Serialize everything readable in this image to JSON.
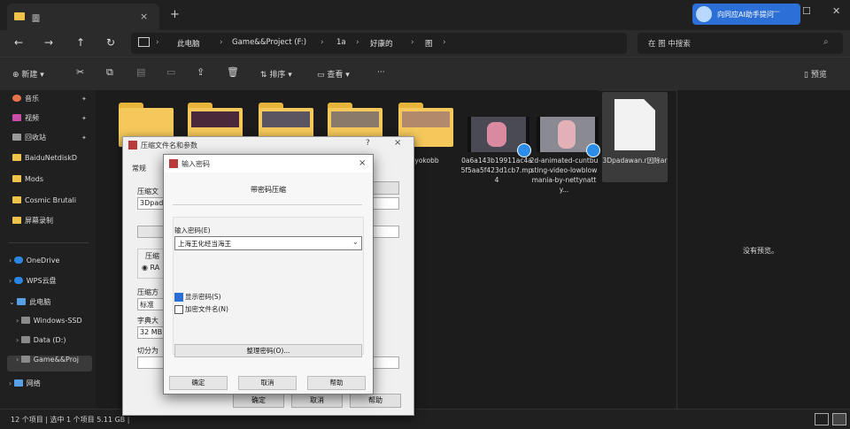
{
  "window": {
    "tab_title": "圖",
    "tab_close": "×",
    "new_tab": "+",
    "badge": "向同应AI助手提问",
    "min": "—",
    "max": "☐",
    "close": "✕"
  },
  "nav": {
    "back": "←",
    "forward": "→",
    "up": "↑",
    "refresh": "↻",
    "breadcrumbs": [
      "此电脑",
      "Game&&Project (F:)",
      "1a",
      "好康的",
      "图"
    ],
    "search_placeholder": "在 图 中搜索"
  },
  "toolbar": {
    "new_label": "新建",
    "sort_label": "排序",
    "view_label": "查看",
    "more_label": "···",
    "details_label": "预览",
    "icons": [
      "cut-icon",
      "copy-icon",
      "paste-icon",
      "rename-icon",
      "share-icon",
      "delete-icon"
    ]
  },
  "sidebar": {
    "pinned": [
      {
        "label": "音乐",
        "color": "#e8734a"
      },
      {
        "label": "视频",
        "color": "#c74fa8"
      },
      {
        "label": "回收站",
        "color": "#9a9a9a"
      }
    ],
    "folders": [
      {
        "label": "BaiduNetdiskD"
      },
      {
        "label": "Mods"
      },
      {
        "label": "Cosmic Brutali"
      },
      {
        "label": "屏幕录制"
      }
    ],
    "drives": [
      {
        "label": "OneDrive",
        "color": "#2a86e0"
      },
      {
        "label": "WPS云盘",
        "color": "#2a86e0"
      },
      {
        "label": "此电脑",
        "color": "#5aa0e8"
      },
      {
        "label": "Windows-SSD",
        "color": "#8a8a8a"
      },
      {
        "label": "Data (D:)",
        "color": "#8a8a8a"
      },
      {
        "label": "Game&&Proj",
        "color": "#8a8a8a"
      },
      {
        "label": "网络",
        "color": "#5aa0e8"
      }
    ]
  },
  "files": [
    {
      "name": "yokobb",
      "type": "folder"
    },
    {
      "name": "0a6a143b19911ac4a5f5aa5f423d1cb7.mp4",
      "type": "video"
    },
    {
      "name": "2d-animated-cuntbusting-video-lowblowmania-by-nettynatty...",
      "type": "video"
    },
    {
      "name": "3Dpadawan.r因除ar",
      "type": "archive"
    }
  ],
  "preview": {
    "empty_text": "没有预览。"
  },
  "status": {
    "text": "12 个项目  |  选中 1 个项目  5.11 GB  |"
  },
  "archive_dialog": {
    "title": "压缩文件名和参数",
    "help": "?",
    "close": "×",
    "tab_general": "常规",
    "filename_label": "压缩文",
    "filename_value": "3Dpad",
    "format_label": "压缩",
    "format_option": "RA",
    "method_label": "压缩方",
    "method_value": "标准",
    "dict_label": "字典大",
    "dict_value": "32 MB",
    "split_label": "切分为",
    "btn_ok": "确定",
    "btn_cancel": "取消",
    "btn_help": "帮助"
  },
  "password_dialog": {
    "title": "输入密码",
    "close": "×",
    "heading": "带密码压缩",
    "label": "输入密码(E)",
    "value": "上海王化经当海王",
    "show_password": "显示密码(S)",
    "encrypt_names": "加密文件名(N)",
    "show_password_checked": true,
    "encrypt_names_checked": false,
    "organize_button": "整理密码(O)...",
    "btn_ok": "确定",
    "btn_cancel": "取消",
    "btn_help": "帮助"
  }
}
